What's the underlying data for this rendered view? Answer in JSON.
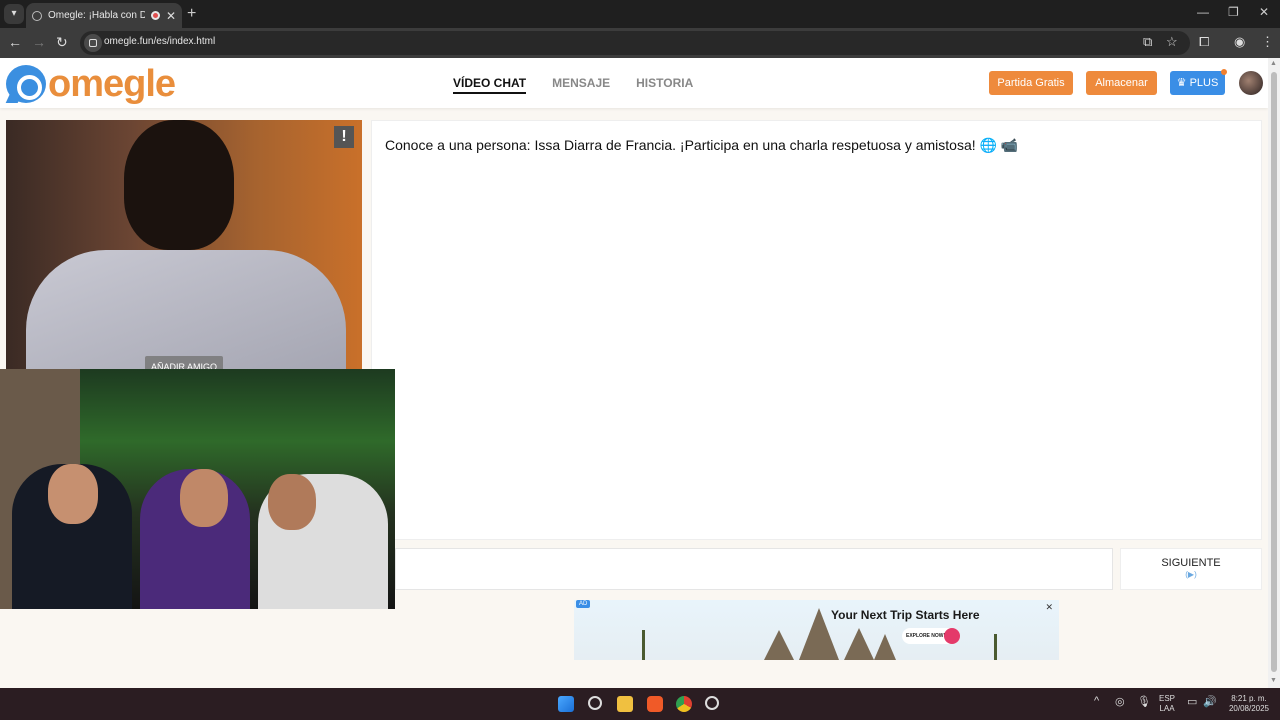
{
  "browser": {
    "tab_title": "Omegle: ¡Habla con Descon",
    "url": "omegle.fun/es/index.html"
  },
  "site": {
    "logo_text": "omegle",
    "nav": [
      {
        "label": "VÍDEO CHAT",
        "active": true
      },
      {
        "label": "MENSAJE",
        "active": false
      },
      {
        "label": "HISTORIA",
        "active": false
      }
    ],
    "btn_partida": "Partida Gratis",
    "btn_almacenar": "Almacenar",
    "btn_plus": "PLUS"
  },
  "video": {
    "report_label": "!",
    "add_friend": "AÑADIR AMIGO"
  },
  "chat": {
    "message": "Conoce a una persona: Issa Diarra de Francia. ¡Participa en una charla respetuosa y amistosa! 🌐 📹",
    "next_label": "SIGUIENTE",
    "next_sub": "(▶)"
  },
  "ad": {
    "badge": "AD",
    "headline": "Your Next Trip Starts Here",
    "cta": "EXPLORE NOW!"
  },
  "taskbar": {
    "lang_top": "ESP",
    "lang_bottom": "LAA",
    "time": "8:21 p. m.",
    "date": "20/08/2025"
  },
  "colors": {
    "brand_orange": "#ee8a3c",
    "brand_blue": "#3a8ee6"
  }
}
